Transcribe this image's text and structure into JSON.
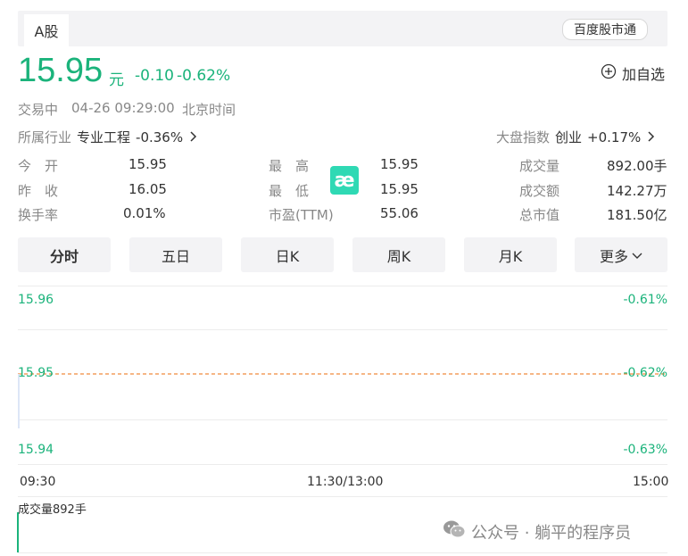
{
  "tabs": {
    "a_share": "A股",
    "baidu": "百度股市通"
  },
  "quote": {
    "price": "15.95",
    "unit": "元",
    "change": "-0.10",
    "change_pct": "-0.62%",
    "add_watch": "加自选",
    "status": "交易中",
    "datetime": "04-26 09:29:00",
    "timezone": "北京时间"
  },
  "industry": {
    "label": "所属行业",
    "name": "专业工程",
    "change": "-0.36%"
  },
  "market_index": {
    "label": "大盘指数",
    "name": "创业",
    "change": "+0.17%"
  },
  "stats": {
    "col1": [
      {
        "label": "今　开",
        "value": "15.95"
      },
      {
        "label": "昨　收",
        "value": "16.05"
      },
      {
        "label": "换手率",
        "value": "0.01%"
      }
    ],
    "col2": [
      {
        "label": "最　高",
        "value": "15.95"
      },
      {
        "label": "最　低",
        "value": "15.95"
      },
      {
        "label": "市盈(TTM)",
        "value": "55.06"
      }
    ],
    "col3": [
      {
        "label": "成交量",
        "value": "892.00手"
      },
      {
        "label": "成交额",
        "value": "142.27万"
      },
      {
        "label": "总市值",
        "value": "181.50亿"
      }
    ]
  },
  "logo_text": "æ",
  "period_buttons": [
    "分时",
    "五日",
    "日K",
    "周K",
    "月K",
    "更多"
  ],
  "chart": {
    "left_axis": [
      "15.96",
      "15.95",
      "15.94"
    ],
    "right_axis": [
      "-0.61%",
      "-0.62%",
      "-0.63%"
    ],
    "times": [
      "09:30",
      "11:30/13:00",
      "15:00"
    ],
    "volume_label": "成交量892手",
    "ref_line_color": "#f08a3c",
    "up_color": "#1bb37b"
  },
  "watermark": "公众号 · 躺平的程序员"
}
